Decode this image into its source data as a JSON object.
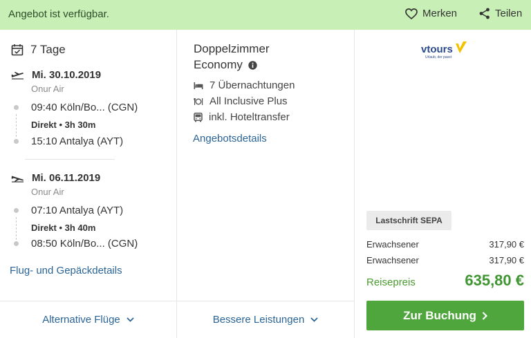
{
  "header": {
    "status": "Angebot ist verfügbar.",
    "merken_label": "Merken",
    "teilen_label": "Teilen"
  },
  "flight": {
    "duration_label": "7 Tage",
    "outbound": {
      "date": "Mi. 30.10.2019",
      "airline": "Onur Air",
      "departure": "09:40 Köln/Bo... (CGN)",
      "direct_label": "Direkt",
      "flight_time": "3h 30m",
      "arrival": "15:10 Antalya (AYT)"
    },
    "return": {
      "date": "Mi. 06.11.2019",
      "airline": "Onur Air",
      "departure": "07:10 Antalya (AYT)",
      "direct_label": "Direkt",
      "flight_time": "3h 40m",
      "arrival": "08:50 Köln/Bo... (CGN)"
    },
    "details_link": "Flug- und Gepäckdetails"
  },
  "hotel": {
    "room_line1": "Doppelzimmer",
    "room_line2": "Economy",
    "features": [
      "7 Übernachtungen",
      "All Inclusive Plus",
      "inkl. Hoteltransfer"
    ],
    "details_link": "Angebotsdetails"
  },
  "offer": {
    "operator_logo_text": "vtours",
    "operator_tagline": "Urlaub, der passt",
    "payment_badge": "Lastschrift SEPA",
    "prices": [
      {
        "label": "Erwachsener",
        "value": "317,90 €"
      },
      {
        "label": "Erwachsener",
        "value": "317,90 €"
      }
    ],
    "total_label": "Reisepreis",
    "total_value": "635,80 €",
    "book_label": "Zur Buchung"
  },
  "footer": {
    "alternative_flights": "Alternative Flüge",
    "better_services": "Bessere Leistungen"
  },
  "colors": {
    "banner": "#c7efb6",
    "link": "#2a6496",
    "price_green": "#3f9531",
    "button_green": "#4fa63c",
    "logo_blue": "#2b4a8c",
    "logo_yellow": "#f2c200"
  }
}
